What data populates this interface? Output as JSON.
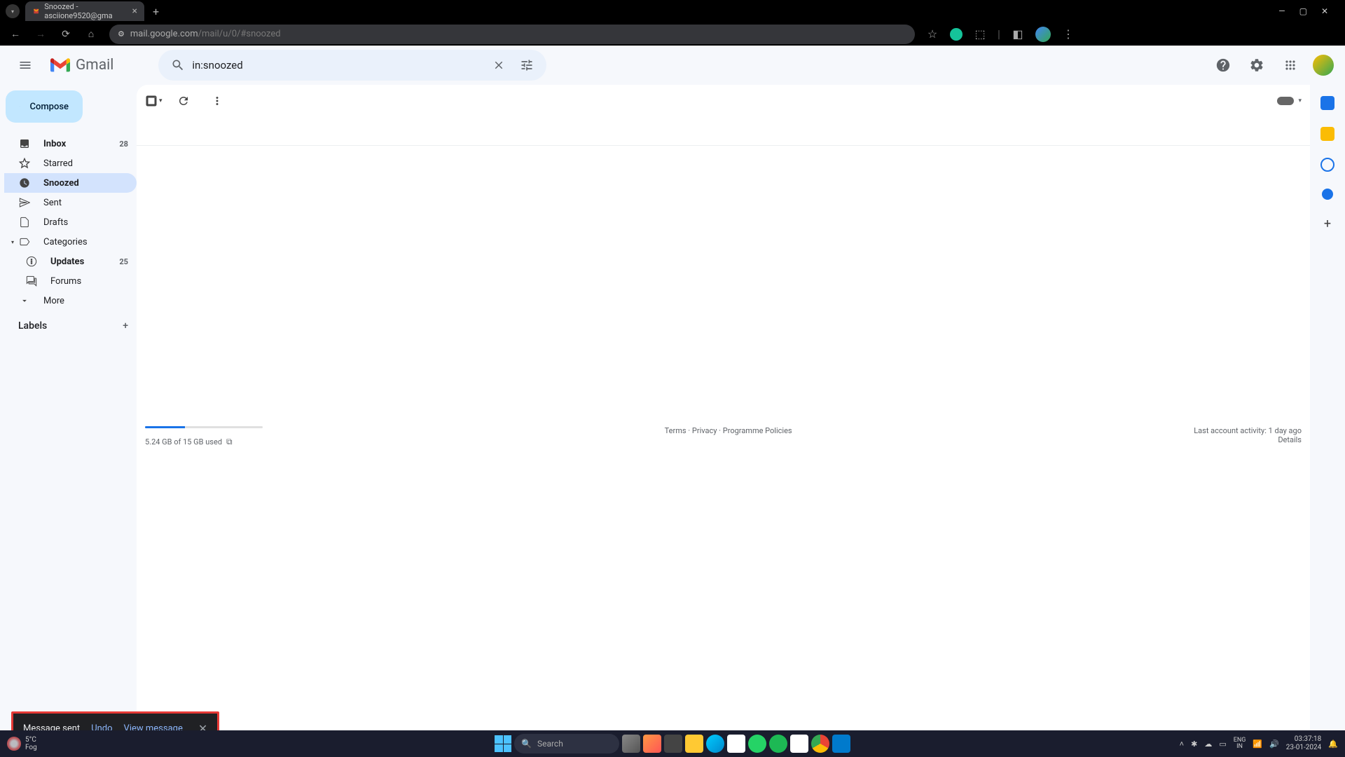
{
  "browser": {
    "tab_title": "Snoozed - asciione9520@gma",
    "url_host": "mail.google.com",
    "url_path": "/mail/u/0/#snoozed"
  },
  "header": {
    "app_name": "Gmail",
    "search_query": "in:snoozed"
  },
  "sidebar": {
    "compose": "Compose",
    "items": [
      {
        "label": "Inbox",
        "count": "28",
        "bold": true
      },
      {
        "label": "Starred"
      },
      {
        "label": "Snoozed",
        "active": true
      },
      {
        "label": "Sent"
      },
      {
        "label": "Drafts"
      },
      {
        "label": "Categories"
      },
      {
        "label": "Updates",
        "count": "25",
        "sub": true,
        "bold": true
      },
      {
        "label": "Forums",
        "sub": true
      },
      {
        "label": "More"
      }
    ],
    "labels_header": "Labels"
  },
  "footer": {
    "storage": "5.24 GB of 15 GB used",
    "terms": "Terms",
    "privacy": "Privacy",
    "policies": "Programme Policies",
    "activity": "Last account activity: 1 day ago",
    "details": "Details"
  },
  "toast": {
    "message": "Message sent",
    "undo": "Undo",
    "view": "View message"
  },
  "taskbar": {
    "temp": "5°C",
    "condition": "Fog",
    "search_placeholder": "Search",
    "lang1": "ENG",
    "lang2": "IN",
    "time": "03:37:18",
    "date": "23-01-2024"
  }
}
